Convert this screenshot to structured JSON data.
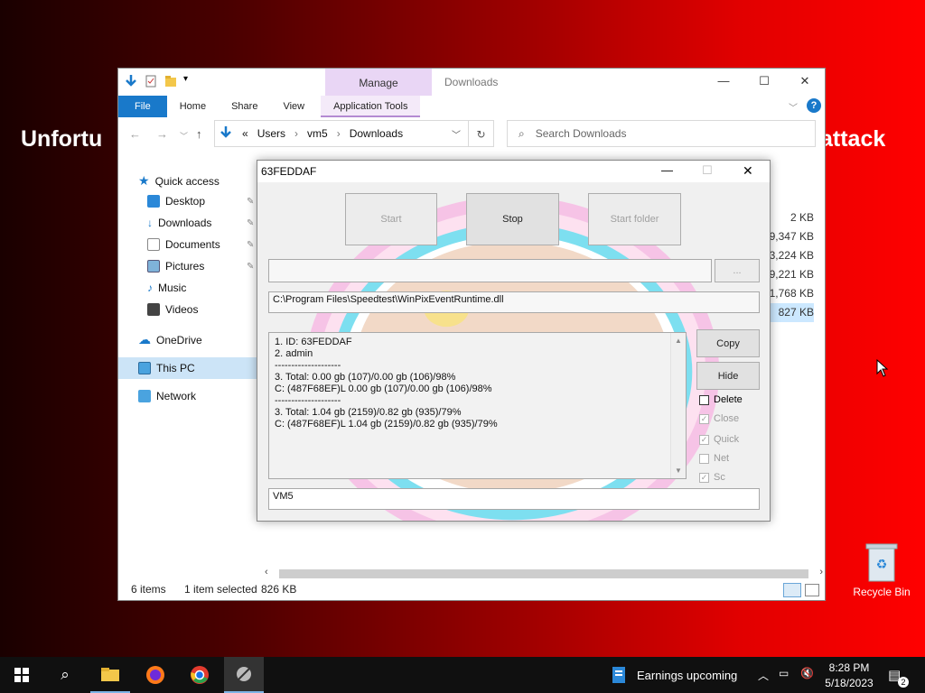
{
  "wallpaper": {
    "text_left": "Unfortu",
    "text_right": "attack"
  },
  "explorer": {
    "title": "Downloads",
    "manage_tab": "Manage",
    "ribbon_tabs": [
      "File",
      "Home",
      "Share",
      "View",
      "Application Tools"
    ],
    "address": {
      "prefix": "«",
      "path": [
        "Users",
        "vm5",
        "Downloads"
      ]
    },
    "search_placeholder": "Search Downloads",
    "nav": {
      "quick_access": "Quick access",
      "desktop": "Desktop",
      "downloads": "Downloads",
      "documents": "Documents",
      "pictures": "Pictures",
      "music": "Music",
      "videos": "Videos",
      "onedrive": "OneDrive",
      "this_pc": "This PC",
      "network": "Network"
    },
    "file_sizes": [
      "2 KB",
      "9,347 KB",
      "3,224 KB",
      "9,221 KB",
      "1,768 KB",
      "827 KB"
    ],
    "status": {
      "items": "6 items",
      "selected": "1 item selected",
      "size": "826 KB"
    }
  },
  "dialog": {
    "title": "63FEDDAF",
    "buttons": {
      "start": "Start",
      "stop": "Stop",
      "start_folder": "Start folder",
      "browse": "...",
      "copy": "Copy",
      "hide": "Hide"
    },
    "path_field": "C:\\Program Files\\Speedtest\\WinPixEventRuntime.dll",
    "log_lines": [
      "1. ID: 63FEDDAF",
      "2. admin",
      "--------------------",
      "3. Total: 0.00 gb (107)/0.00 gb (106)/98%",
      "C: (487F68EF)L 0.00 gb (107)/0.00 gb (106)/98%",
      "--------------------",
      "3. Total: 1.04 gb (2159)/0.82 gb (935)/79%",
      "C: (487F68EF)L 1.04 gb (2159)/0.82 gb (935)/79%"
    ],
    "checkboxes": {
      "delete": {
        "label": "Delete",
        "checked": false
      },
      "close": {
        "label": "Close",
        "checked": true
      },
      "quick": {
        "label": "Quick",
        "checked": true
      },
      "net": {
        "label": "Net",
        "checked": false
      },
      "sc": {
        "label": "Sc",
        "checked": true
      }
    },
    "bottom_field": "VM5"
  },
  "desktop": {
    "recycle_bin": "Recycle Bin"
  },
  "taskbar": {
    "weather": "Earnings upcoming",
    "time": "8:28 PM",
    "date": "5/18/2023",
    "notification_count": "2"
  },
  "colors": {
    "wallpaper_red": "#ff0000",
    "explorer_accent": "#1979ca",
    "manage_tab": "#e9d6f5"
  }
}
